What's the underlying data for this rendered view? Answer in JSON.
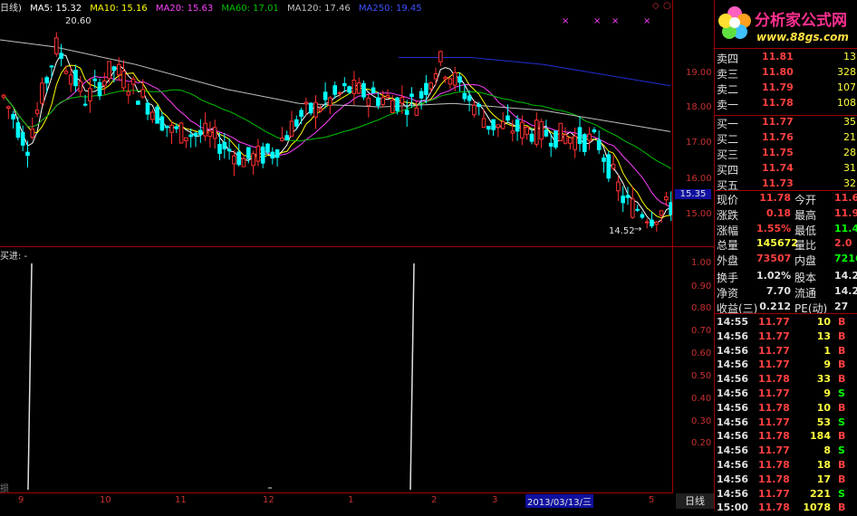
{
  "topbar": {
    "period": "日线)",
    "ma5": "MA5: 15.32",
    "ma10": "MA10: 15.16",
    "ma20": "MA20: 15.63",
    "ma60": "MA60: 17.01",
    "ma120": "MA120: 17.46",
    "ma250": "MA250: 19.45"
  },
  "colors": {
    "ma5": "#ffffff",
    "ma10": "#ffff00",
    "ma20": "#ff40ff",
    "ma60": "#00c000",
    "ma120": "#c0c0c0",
    "ma250": "#2030d0",
    "up": "#ff3030",
    "down": "#00ffff"
  },
  "main_chart": {
    "high_label": "20.60",
    "low_label": "14.52",
    "current_price_tag": "15.35",
    "y_ticks": [
      "19.00",
      "18.00",
      "17.00",
      "16.00",
      "15.00"
    ]
  },
  "indicator": {
    "title": "买进: -",
    "y_ticks": [
      "1.00",
      "0.90",
      "0.80",
      "0.70",
      "0.60",
      "0.50",
      "0.40",
      "0.30",
      "0.20"
    ],
    "footer_mark": "损"
  },
  "xaxis": {
    "labels": [
      "9",
      "10",
      "11",
      "12",
      "1",
      "2",
      "3",
      "5"
    ],
    "date_box": "2013/03/13/三",
    "daily_tab": "日线"
  },
  "panel": {
    "logo_title": "分析家公式网",
    "logo_url": "www.88gs.com",
    "order_book": [
      {
        "label": "卖四",
        "price": "11.81",
        "vol": "13"
      },
      {
        "label": "卖三",
        "price": "11.80",
        "vol": "328"
      },
      {
        "label": "卖二",
        "price": "11.79",
        "vol": "107"
      },
      {
        "label": "卖一",
        "price": "11.78",
        "vol": "108"
      },
      {
        "label": "买一",
        "price": "11.77",
        "vol": "35"
      },
      {
        "label": "买二",
        "price": "11.76",
        "vol": "21"
      },
      {
        "label": "买三",
        "price": "11.75",
        "vol": "28"
      },
      {
        "label": "买四",
        "price": "11.74",
        "vol": "31"
      },
      {
        "label": "买五",
        "price": "11.73",
        "vol": "32"
      }
    ],
    "stats": [
      {
        "l1": "现价",
        "v1": "11.78",
        "c1": "#ff4040",
        "l2": "今开",
        "v2": "11.6",
        "c2": "#ff4040"
      },
      {
        "l1": "涨跌",
        "v1": "0.18",
        "c1": "#ff4040",
        "l2": "最高",
        "v2": "11.9",
        "c2": "#ff4040"
      },
      {
        "l1": "涨幅",
        "v1": "1.55%",
        "c1": "#ff4040",
        "l2": "最低",
        "v2": "11.4",
        "c2": "#00ff00"
      },
      {
        "l1": "总量",
        "v1": "145672",
        "c1": "#ffff40",
        "l2": "量比",
        "v2": "2.0",
        "c2": "#ff4040"
      },
      {
        "l1": "外盘",
        "v1": "73507",
        "c1": "#ff4040",
        "l2": "内盘",
        "v2": "7216",
        "c2": "#00ff00"
      },
      {
        "l1": "换手",
        "v1": "1.02%",
        "c1": "#e0e0e0",
        "l2": "股本",
        "v2": "14.2",
        "c2": "#e0e0e0"
      },
      {
        "l1": "净资",
        "v1": "7.70",
        "c1": "#e0e0e0",
        "l2": "流通",
        "v2": "14.2",
        "c2": "#e0e0e0"
      },
      {
        "l1": "收益(三)",
        "v1": "0.212",
        "c1": "#e0e0e0",
        "l2": "PE(动)",
        "v2": "27",
        "c2": "#e0e0e0"
      }
    ],
    "trades": [
      {
        "time": "14:55",
        "price": "11.77",
        "vol": "10",
        "side": "B"
      },
      {
        "time": "14:56",
        "price": "11.77",
        "vol": "13",
        "side": "B"
      },
      {
        "time": "14:56",
        "price": "11.77",
        "vol": "1",
        "side": "B"
      },
      {
        "time": "14:56",
        "price": "11.77",
        "vol": "9",
        "side": "B"
      },
      {
        "time": "14:56",
        "price": "11.78",
        "vol": "33",
        "side": "B"
      },
      {
        "time": "14:56",
        "price": "11.77",
        "vol": "9",
        "side": "S"
      },
      {
        "time": "14:56",
        "price": "11.78",
        "vol": "10",
        "side": "B"
      },
      {
        "time": "14:56",
        "price": "11.77",
        "vol": "53",
        "side": "S"
      },
      {
        "time": "14:56",
        "price": "11.78",
        "vol": "184",
        "side": "B"
      },
      {
        "time": "14:56",
        "price": "11.77",
        "vol": "8",
        "side": "S"
      },
      {
        "time": "14:56",
        "price": "11.78",
        "vol": "18",
        "side": "B"
      },
      {
        "time": "14:56",
        "price": "11.78",
        "vol": "17",
        "side": "B"
      },
      {
        "time": "14:56",
        "price": "11.77",
        "vol": "221",
        "side": "S"
      },
      {
        "time": "15:00",
        "price": "11.78",
        "vol": "1078",
        "side": "B"
      }
    ]
  }
}
